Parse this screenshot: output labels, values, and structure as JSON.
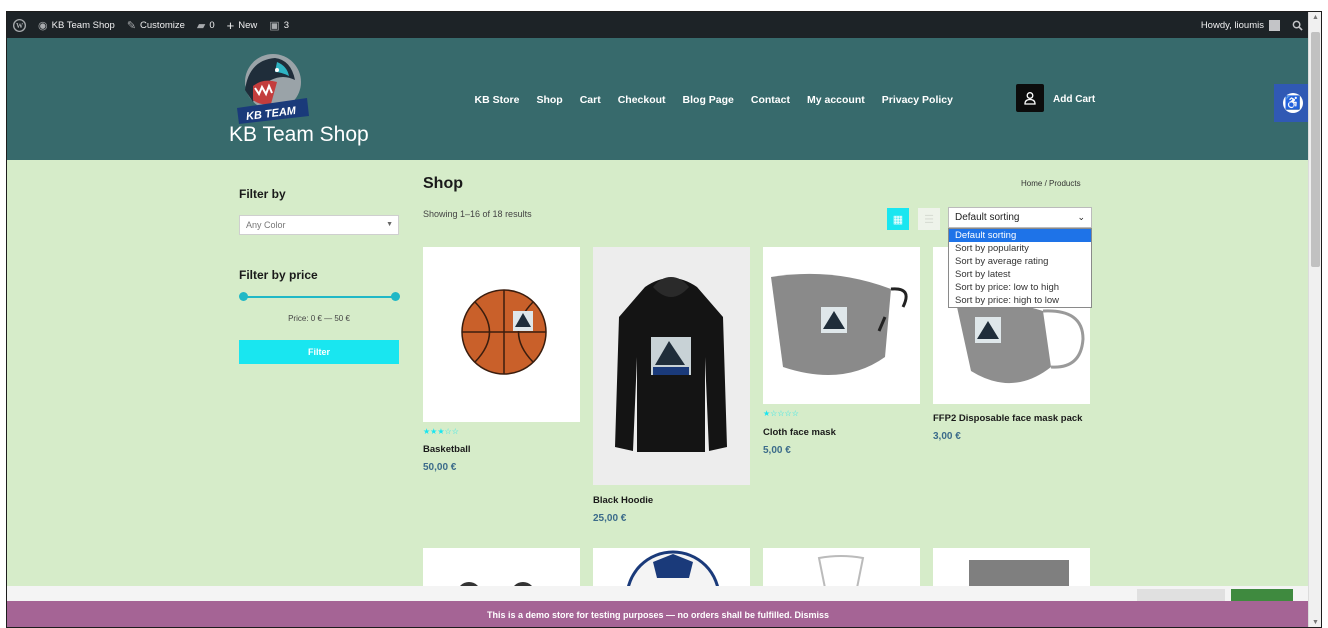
{
  "admin_bar": {
    "wp_logo": "wordpress-icon",
    "site_name": "KB Team Shop",
    "customize": "Customize",
    "comments_count": "0",
    "new_label": "New",
    "updates_count": "3",
    "greeting": "Howdy, lioumis"
  },
  "header": {
    "logo_text": "KB TEAM",
    "site_title": "KB Team Shop",
    "nav": [
      "KB Store",
      "Shop",
      "Cart",
      "Checkout",
      "Blog Page",
      "Contact",
      "My account",
      "Privacy Policy"
    ],
    "cart_label": "Add Cart"
  },
  "sidebar": {
    "filter_title": "Filter by",
    "color_placeholder": "Any Color",
    "price_title": "Filter by price",
    "price_range": "Price: 0 € — 50 €",
    "filter_button": "Filter"
  },
  "shop": {
    "title": "Shop",
    "breadcrumb": "Home / Products",
    "result_count": "Showing 1–16 of 18 results",
    "sort_selected": "Default sorting",
    "sort_options": [
      "Default sorting",
      "Sort by popularity",
      "Sort by average rating",
      "Sort by latest",
      "Sort by price: low to high",
      "Sort by price: high to low"
    ]
  },
  "products": [
    {
      "name": "Basketball",
      "price": "50,00 €",
      "rating": 3,
      "stars": "★★★☆☆"
    },
    {
      "name": "Black Hoodie",
      "price": "25,00 €",
      "rating": 0,
      "stars": ""
    },
    {
      "name": "Cloth face mask",
      "price": "5,00 €",
      "rating": 1,
      "stars": "★☆☆☆☆"
    },
    {
      "name": "FFP2 Disposable face mask pack",
      "price": "3,00 €",
      "rating": 0,
      "stars": ""
    }
  ],
  "demo_notice": "This is a demo store for testing purposes — no orders shall be fulfilled. Dismiss",
  "colors": {
    "header_bg": "#376a6c",
    "page_bg": "#d6ecc9",
    "accent": "#19e6f0",
    "demo_bar": "#a56495",
    "admin_bar": "#1d2327"
  }
}
